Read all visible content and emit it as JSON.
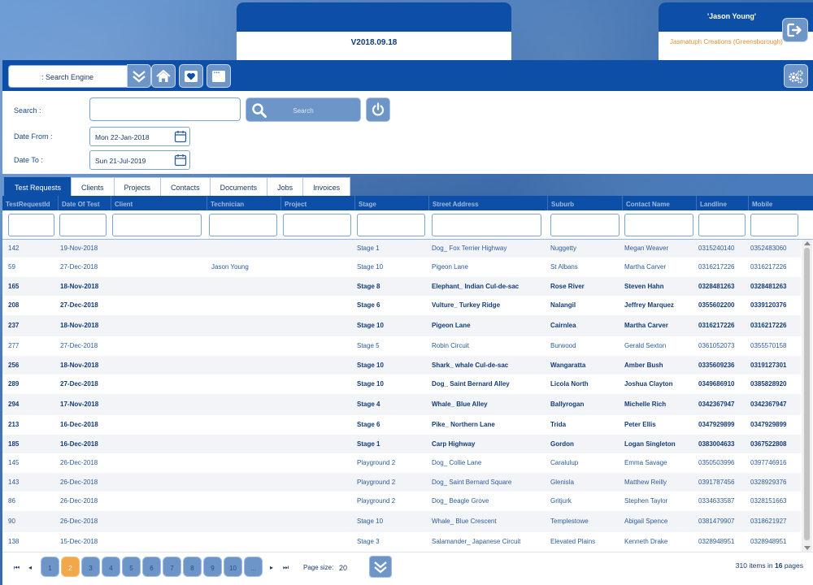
{
  "header": {
    "version": "V2018.09.18",
    "user_name": "'Jason Young'",
    "company": "Jasmatuph Creations (Greensborough)"
  },
  "toolbar": {
    "engine_label": ": Search Engine",
    "icons": [
      "double-chevron-down-icon",
      "home-icon",
      "heart-icon",
      "window-icon",
      "settings-icon"
    ]
  },
  "search": {
    "search_label": "Search :",
    "search_button": "Search",
    "date_from_label": "Date From :",
    "date_from": "Mon 22-Jan-2018",
    "date_to_label": "Date To :",
    "date_to": "Sun 21-Jul-2019"
  },
  "tabs": [
    "Test Requests",
    "Clients",
    "Projects",
    "Contacts",
    "Documents",
    "Jobs",
    "Invoices"
  ],
  "grid": {
    "columns": [
      "TestRequestId",
      "Date Of Test",
      "Client",
      "Technician",
      "Project",
      "Stage",
      "Street Address",
      "Suburb",
      "Contact Name",
      "Landline",
      "Mobile"
    ],
    "rows": [
      {
        "id": "142",
        "date": "19-Nov-2018",
        "client": "",
        "tech": "",
        "project": "",
        "stage": "Stage 1",
        "street": "Dog_ Fox Terrier Highway",
        "suburb": "Nuggetty",
        "contact": "Megan Weaver",
        "landline": "0315240140",
        "mobile": "0352483060",
        "bold": false
      },
      {
        "id": "59",
        "date": "27-Dec-2018",
        "client": "",
        "tech": "Jason Young",
        "project": "",
        "stage": "Stage 10",
        "street": "Pigeon Lane",
        "suburb": "St Albans",
        "contact": "Martha Carver",
        "landline": "0316217226",
        "mobile": "0316217226",
        "bold": false
      },
      {
        "id": "165",
        "date": "18-Nov-2018",
        "client": "",
        "tech": "",
        "project": "",
        "stage": "Stage 8",
        "street": "Elephant_ Indian Cul-de-sac",
        "suburb": "Rose River",
        "contact": "Steven Hahn",
        "landline": "0328481263",
        "mobile": "0328481263",
        "bold": true
      },
      {
        "id": "208",
        "date": "27-Dec-2018",
        "client": "",
        "tech": "",
        "project": "",
        "stage": "Stage 6",
        "street": "Vulture_ Turkey Ridge",
        "suburb": "Nalangil",
        "contact": "Jeffrey Marquez",
        "landline": "0355602200",
        "mobile": "0339120376",
        "bold": true
      },
      {
        "id": "237",
        "date": "18-Nov-2018",
        "client": "",
        "tech": "",
        "project": "",
        "stage": "Stage 10",
        "street": "Pigeon Lane",
        "suburb": "Cairnlea",
        "contact": "Martha Carver",
        "landline": "0316217226",
        "mobile": "0316217226",
        "bold": true
      },
      {
        "id": "277",
        "date": "27-Dec-2018",
        "client": "",
        "tech": "",
        "project": "",
        "stage": "Stage 5",
        "street": "Robin Circuit",
        "suburb": "Burwood",
        "contact": "Gerald Sexton",
        "landline": "0361052073",
        "mobile": "0355570158",
        "bold": false
      },
      {
        "id": "256",
        "date": "18-Nov-2018",
        "client": "",
        "tech": "",
        "project": "",
        "stage": "Stage 10",
        "street": "Shark_ whale Cul-de-sac",
        "suburb": "Wangaratta",
        "contact": "Amber Bush",
        "landline": "0335609236",
        "mobile": "0319127301",
        "bold": true
      },
      {
        "id": "289",
        "date": "27-Dec-2018",
        "client": "",
        "tech": "",
        "project": "",
        "stage": "Stage 10",
        "street": "Dog_ Saint Bernard Alley",
        "suburb": "Licola North",
        "contact": "Joshua Clayton",
        "landline": "0349686910",
        "mobile": "0385828920",
        "bold": true
      },
      {
        "id": "294",
        "date": "17-Nov-2018",
        "client": "",
        "tech": "",
        "project": "",
        "stage": "Stage 4",
        "street": "Whale_ Blue Alley",
        "suburb": "Ballyrogan",
        "contact": "Michelle Rich",
        "landline": "0342367947",
        "mobile": "0342367947",
        "bold": true
      },
      {
        "id": "213",
        "date": "16-Dec-2018",
        "client": "",
        "tech": "",
        "project": "",
        "stage": "Stage 6",
        "street": "Pike_ Northern Lane",
        "suburb": "Trida",
        "contact": "Peter Ellis",
        "landline": "0347929899",
        "mobile": "0347929899",
        "bold": true
      },
      {
        "id": "185",
        "date": "16-Dec-2018",
        "client": "",
        "tech": "",
        "project": "",
        "stage": "Stage 1",
        "street": "Carp Highway",
        "suburb": "Gordon",
        "contact": "Logan Singleton",
        "landline": "0383004633",
        "mobile": "0367522808",
        "bold": true
      },
      {
        "id": "145",
        "date": "26-Dec-2018",
        "client": "",
        "tech": "",
        "project": "",
        "stage": "Playground 2",
        "street": "Dog_ Collie Lane",
        "suburb": "Caralulup",
        "contact": "Emma Savage",
        "landline": "0350503996",
        "mobile": "0397746916",
        "bold": false
      },
      {
        "id": "143",
        "date": "26-Dec-2018",
        "client": "",
        "tech": "",
        "project": "",
        "stage": "Playground 2",
        "street": "Dog_ Saint Bernard Square",
        "suburb": "Glenisla",
        "contact": "Matthew Reilly",
        "landline": "0391787456",
        "mobile": "0328929376",
        "bold": false
      },
      {
        "id": "86",
        "date": "26-Dec-2018",
        "client": "",
        "tech": "",
        "project": "",
        "stage": "Playground 2",
        "street": "Dog_ Beagle Grove",
        "suburb": "Gritjurk",
        "contact": "Stephen Taylor",
        "landline": "0334633587",
        "mobile": "0328151663",
        "bold": false
      },
      {
        "id": "90",
        "date": "26-Dec-2018",
        "client": "",
        "tech": "",
        "project": "",
        "stage": "Stage 10",
        "street": "Whale_ Blue Crescent",
        "suburb": "Templestowe",
        "contact": "Abigail Spence",
        "landline": "0381479907",
        "mobile": "0318621927",
        "bold": false
      },
      {
        "id": "138",
        "date": "15-Dec-2018",
        "client": "",
        "tech": "",
        "project": "",
        "stage": "Stage 3",
        "street": "Salamander_ Japanese Circuit",
        "suburb": "Elevated Plains",
        "contact": "Kenneth Drake",
        "landline": "0328948951",
        "mobile": "0328948951",
        "bold": false
      }
    ]
  },
  "pager": {
    "first": "⏮",
    "prev": "◂",
    "next": "▸",
    "last": "⏭",
    "pages": [
      "1",
      "2",
      "3",
      "4",
      "5",
      "6",
      "7",
      "8",
      "9",
      "10",
      "..."
    ],
    "active_page": "2",
    "page_size_label": "Page size:",
    "page_size": "20",
    "items_info_prefix": "310 items in ",
    "items_info_pages": "16",
    "items_info_suffix": " pages"
  },
  "colors": {
    "primary": "#0d4ea6",
    "button": "#6e95c8",
    "accent": "#f2a84a",
    "company": "#e0913a"
  }
}
